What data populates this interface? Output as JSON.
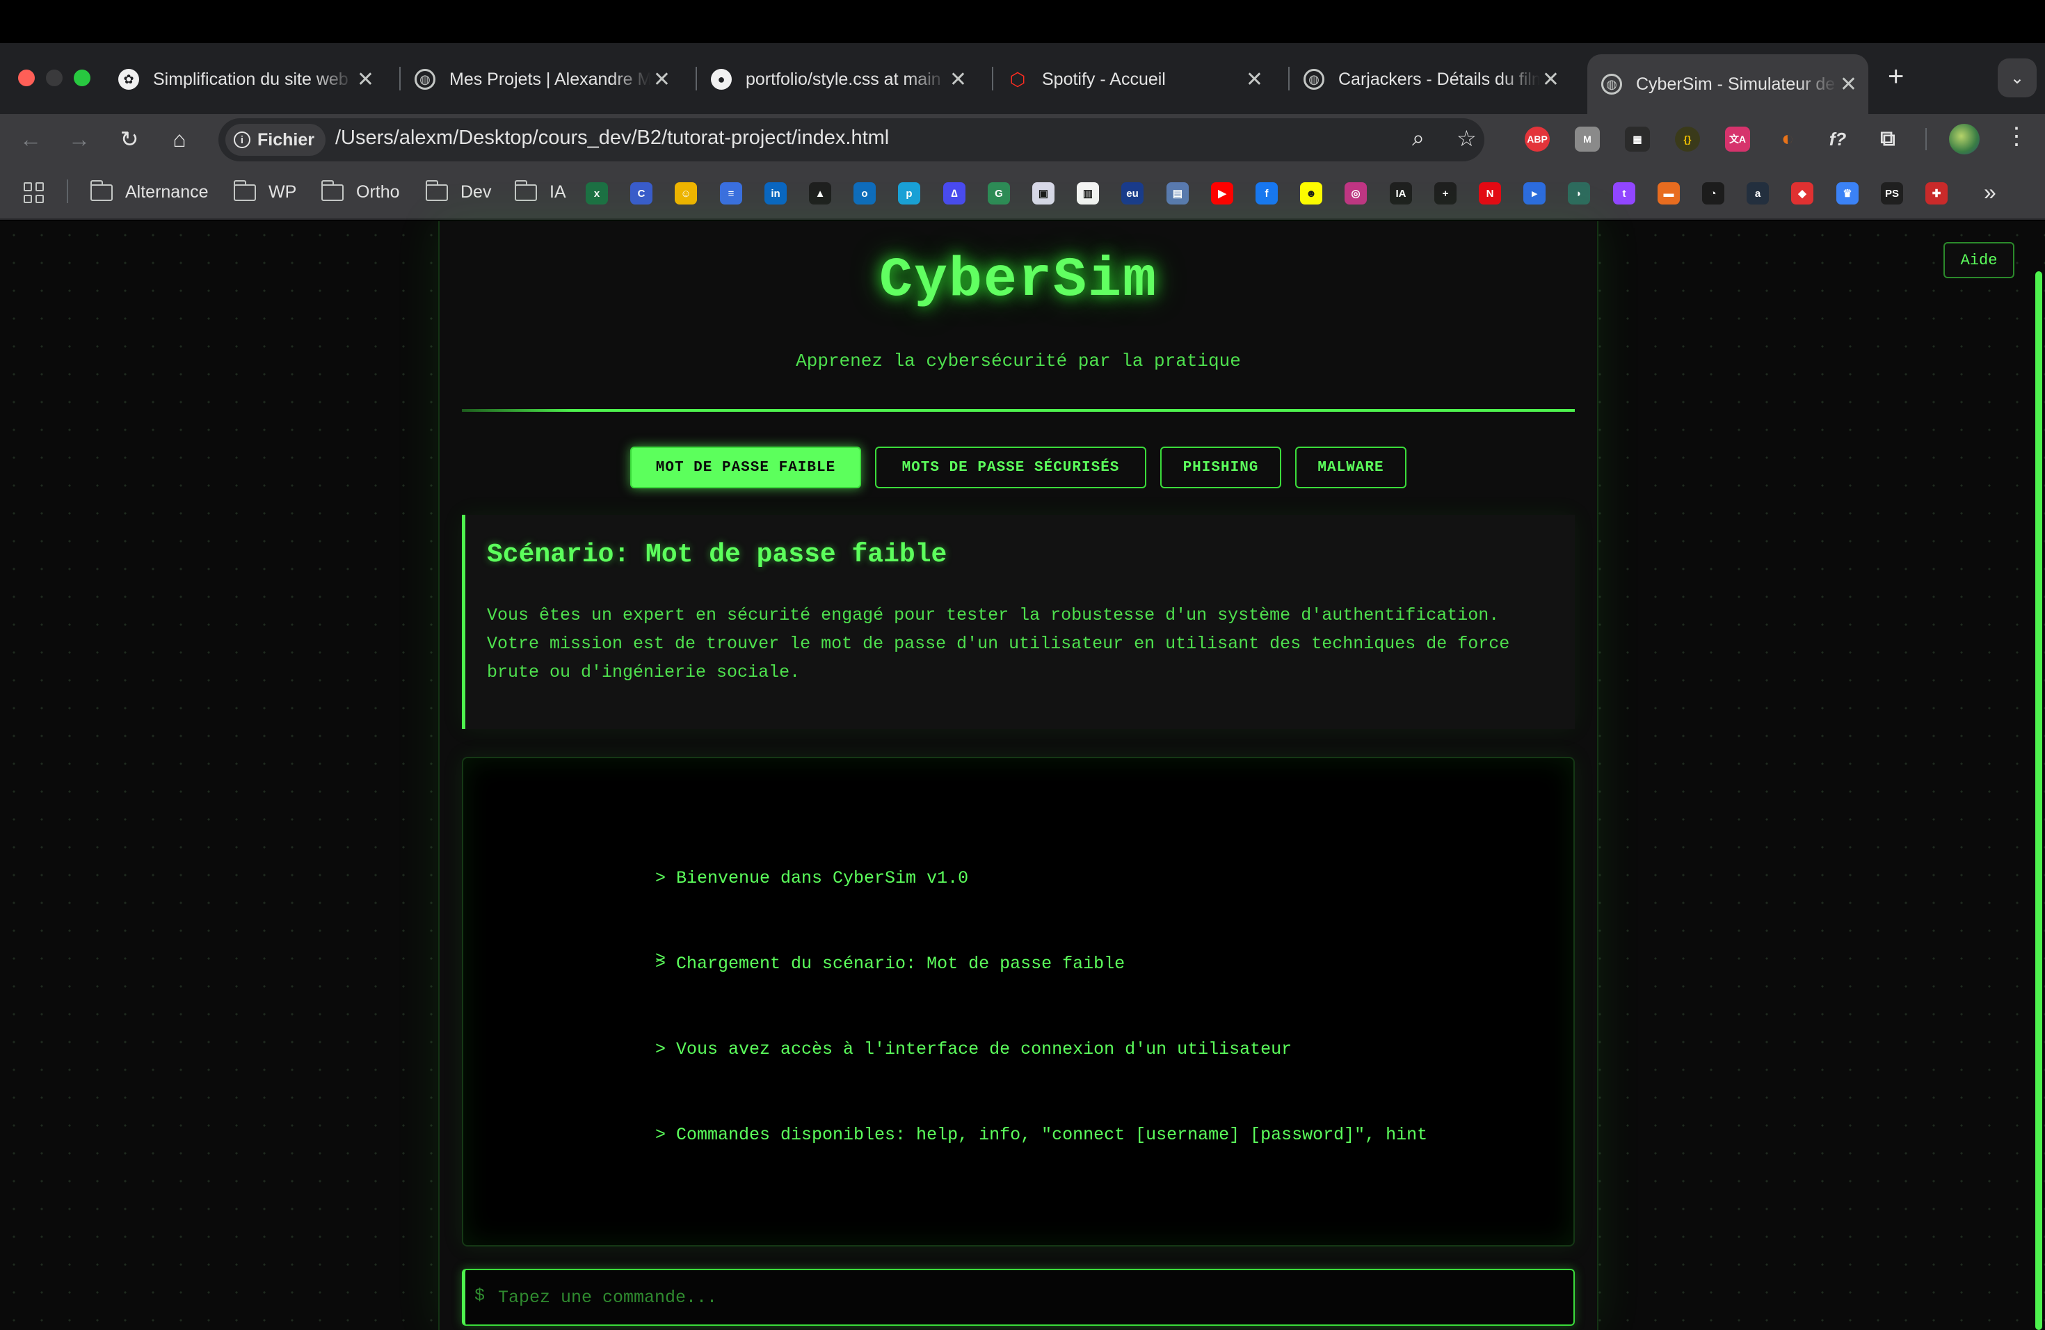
{
  "browser": {
    "tabs": [
      {
        "title": "Simplification du site web",
        "favicon": "openai-icon"
      },
      {
        "title": "Mes Projets | Alexandre M",
        "favicon": "globe-icon"
      },
      {
        "title": "portfolio/style.css at main",
        "favicon": "github-icon"
      },
      {
        "title": "Spotify - Accueil",
        "favicon": "laravel-icon"
      },
      {
        "title": "Carjackers - Détails du film",
        "favicon": "globe-icon"
      },
      {
        "title": "CyberSim - Simulateur de",
        "favicon": "globe-icon",
        "active": true
      }
    ],
    "new_tab": "+",
    "tab_close": "✕",
    "chip_label": "Fichier",
    "url": "/Users/alexm/Desktop/cours_dev/B2/tutorat-project/index.html",
    "bookmark_folders": [
      "Alternance",
      "WP",
      "Ortho",
      "Dev",
      "IA"
    ],
    "extensions": [
      {
        "label": "ABP",
        "color": "#e3343a"
      },
      {
        "label": "M",
        "color": "#8a8a8a"
      },
      {
        "label": "▦",
        "color": "#2b2b2b"
      },
      {
        "label": "{}",
        "color": "#3a3a1a"
      },
      {
        "label": "文A",
        "color": "#d6336c"
      },
      {
        "label": "◐",
        "color": "#e8731a"
      },
      {
        "label": "f?",
        "color": "#3c3c3f"
      }
    ],
    "bookmark_sites": [
      {
        "label": "x",
        "color": "#1d7044"
      },
      {
        "label": "C",
        "color": "#3a5ccc"
      },
      {
        "label": "☺",
        "color": "#f0b400"
      },
      {
        "label": "≡",
        "color": "#3b6fe0"
      },
      {
        "label": "in",
        "color": "#0a66c2"
      },
      {
        "label": "▲",
        "color": "#1f1f1f"
      },
      {
        "label": "o",
        "color": "#0f6cbd"
      },
      {
        "label": "p",
        "color": "#1aa0d8"
      },
      {
        "label": "∆",
        "color": "#4a4af0"
      },
      {
        "label": "G",
        "color": "#2e8b57"
      },
      {
        "label": "▣",
        "color": "#d8d8e8"
      },
      {
        "label": "▥",
        "color": "#f4f4f4"
      },
      {
        "label": "eu",
        "color": "#1a3b8c"
      },
      {
        "label": "▤",
        "color": "#5a7ab0"
      },
      {
        "label": "▶",
        "color": "#ff0000"
      },
      {
        "label": "f",
        "color": "#1877f2"
      },
      {
        "label": "☻",
        "color": "#fffc00"
      },
      {
        "label": "◎",
        "color": "#c13584"
      },
      {
        "label": "IA",
        "color": "#1f1f1f"
      },
      {
        "label": "+",
        "color": "#1f1f1f"
      },
      {
        "label": "N",
        "color": "#e50914"
      },
      {
        "label": "▸",
        "color": "#2d6cdf"
      },
      {
        "label": "◗",
        "color": "#2e6b5e"
      },
      {
        "label": "t",
        "color": "#9146ff"
      },
      {
        "label": "▬",
        "color": "#e86c1f"
      },
      {
        "label": "◔",
        "color": "#1c1c1c"
      },
      {
        "label": "a",
        "color": "#232f3e"
      },
      {
        "label": "◆",
        "color": "#e03131"
      },
      {
        "label": "♛",
        "color": "#3b82f6"
      },
      {
        "label": "PS",
        "color": "#1f1f1f"
      },
      {
        "label": "✚",
        "color": "#c92a2a"
      }
    ]
  },
  "page": {
    "help_button": "Aide",
    "title": "CyberSim",
    "subtitle": "Apprenez la cybersécurité par la pratique",
    "scenario_tabs": [
      "MOT DE PASSE FAIBLE",
      "MOTS DE PASSE SÉCURISÉS",
      "PHISHING",
      "MALWARE"
    ],
    "active_scenario_tab": "MOT DE PASSE FAIBLE",
    "scenario": {
      "title": "Scénario: Mot de passe faible",
      "description_lines": [
        "Vous êtes un expert en sécurité engagé pour tester la robustesse d'un système d'authentification.",
        "Votre mission est de trouver le mot de passe d'un utilisateur en utilisant des techniques de force",
        "brute ou d'ingénierie sociale."
      ]
    },
    "terminal": {
      "lines": [
        "> Bienvenue dans CyberSim v1.0",
        "> Chargement du scénario: Mot de passe faible",
        "> Vous avez accès à l'interface de connexion d'un utilisateur",
        "> Commandes disponibles: help, info, \"connect [username] [password]\", hint"
      ],
      "prompt": ">"
    },
    "command": {
      "prefix": "$",
      "placeholder": "Tapez une commande...",
      "value": ""
    }
  }
}
